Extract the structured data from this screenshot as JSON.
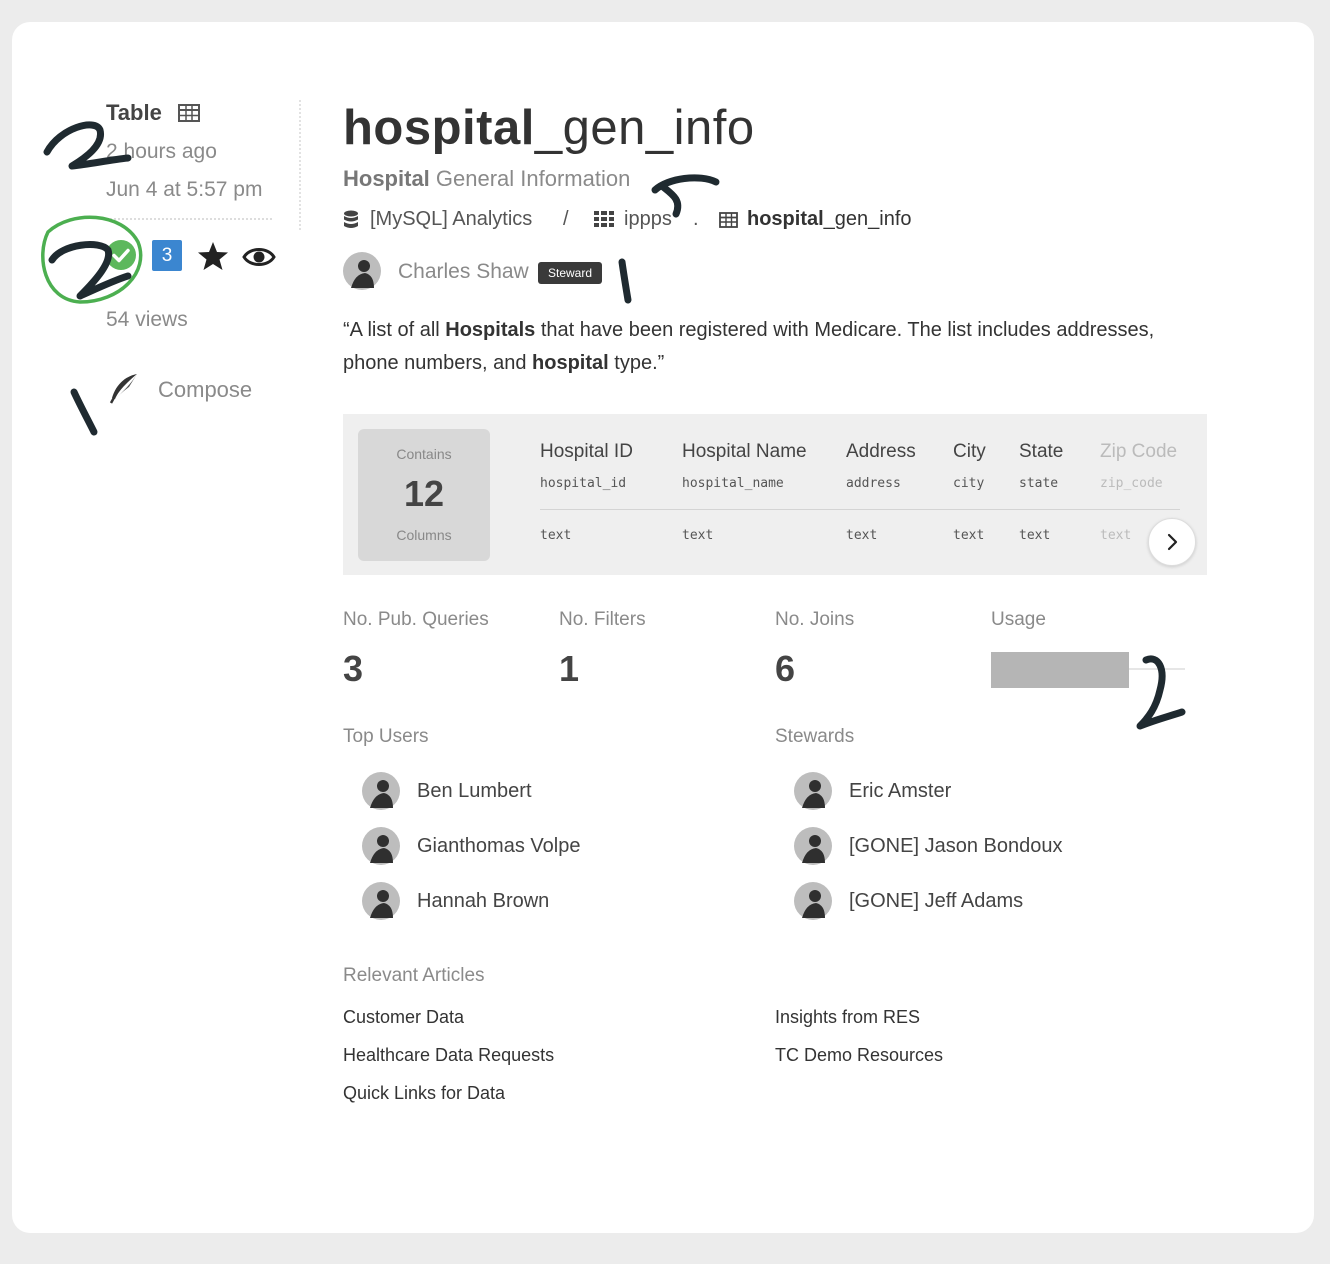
{
  "sidebar": {
    "type_label": "Table",
    "updated": "2 hours ago",
    "date": "Jun 4 at 5:57 pm",
    "badge_count": "3",
    "views": "54 views",
    "compose_label": "Compose",
    "icons": [
      "table-icon",
      "verified-check-icon",
      "star-icon",
      "eye-icon",
      "quill-icon"
    ]
  },
  "header": {
    "title_bold": "hospital",
    "title_rest": "_gen_info",
    "subtitle_bold": "Hospital",
    "subtitle_rest": " General Information",
    "breadcrumb": {
      "source": "[MySQL] Analytics",
      "sep1": "/",
      "schema": "ippps",
      "sep2": ".",
      "table_bold": "hospital",
      "table_rest": "_gen_info"
    },
    "owner": {
      "name": "Charles Shaw",
      "tag": "Steward"
    }
  },
  "description": {
    "p1": "“A list of all ",
    "b1": "Hospitals",
    "p2": " that have been registered with Medicare. The list includes addresses, phone numbers, and ",
    "b2": "hospital",
    "p3": " type.”"
  },
  "columns_panel": {
    "contains_label": "Contains",
    "count": "12",
    "columns_label": "Columns",
    "columns": [
      {
        "title": "Hospital ID",
        "key": "hospital_id",
        "type": "text"
      },
      {
        "title": "Hospital Name",
        "key": "hospital_name",
        "type": "text"
      },
      {
        "title": "Address",
        "key": "address",
        "type": "text"
      },
      {
        "title": "City",
        "key": "city",
        "type": "text"
      },
      {
        "title": "State",
        "key": "state",
        "type": "text"
      },
      {
        "title": "Zip Code",
        "key": "zip_code",
        "type": "text"
      }
    ]
  },
  "stats": [
    {
      "label": "No. Pub. Queries",
      "value": "3"
    },
    {
      "label": "No. Filters",
      "value": "1"
    },
    {
      "label": "No. Joins",
      "value": "6"
    }
  ],
  "usage": {
    "label": "Usage",
    "level_fraction": 0.71
  },
  "top_users": {
    "heading": "Top Users",
    "names": [
      "Ben Lumbert",
      "Gianthomas Volpe",
      "Hannah Brown"
    ]
  },
  "stewards": {
    "heading": "Stewards",
    "names": [
      "Eric Amster",
      "[GONE] Jason Bondoux",
      "[GONE] Jeff Adams"
    ]
  },
  "articles": {
    "heading": "Relevant Articles",
    "left": [
      "Customer Data",
      "Healthcare Data Requests",
      "Quick Links for Data"
    ],
    "right": [
      "Insights from RES",
      "TC Demo Resources"
    ]
  },
  "colors": {
    "verified": "#5cb85c",
    "badge": "#3b86d0",
    "steward_tag": "#3a3a3a",
    "circle_mark": "#4caf50"
  }
}
